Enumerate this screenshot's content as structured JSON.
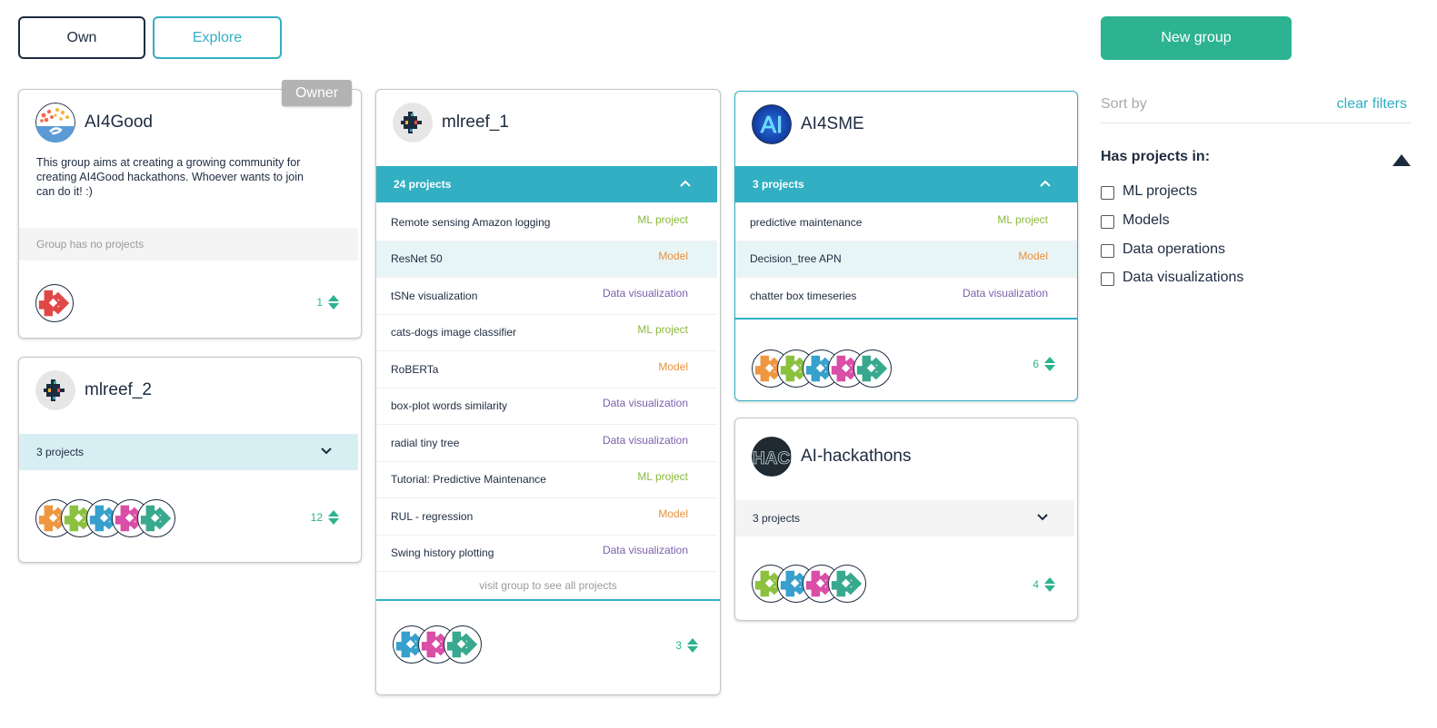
{
  "tabs": {
    "own": "Own",
    "explore": "Explore"
  },
  "new_group_label": "New group",
  "sidebar": {
    "sort_by": "Sort by",
    "clear_filters": "clear filters",
    "filter_heading": "Has projects in:",
    "filters": [
      {
        "label": "ML projects",
        "checked": false
      },
      {
        "label": "Models",
        "checked": false
      },
      {
        "label": "Data operations",
        "checked": false
      },
      {
        "label": "Data visualizations",
        "checked": false
      }
    ]
  },
  "colors": {
    "accent": "#32afc3",
    "primary": "#2db391",
    "dark": "#1d2b40",
    "ml_project": "#8ab93a",
    "model": "#e8923e",
    "data_visualization": "#7a5fad"
  },
  "groups": {
    "ai4good": {
      "name": "AI4Good",
      "badge": "Owner",
      "description": "This group aims at creating a growing community for creating AI4Good hackathons. Whoever wants to join can do it! :)",
      "no_projects": "Group has no projects",
      "member_icons": [
        "red-mlreef-icon"
      ],
      "stars": "1"
    },
    "mlreef_2": {
      "name": "mlreef_2",
      "projects_label": "3 projects",
      "member_icons": [
        "orange-mlreef-icon",
        "green-mlreef-icon",
        "blue-mlreef-icon",
        "pink-mlreef-icon",
        "teal-mlreef-icon"
      ],
      "stars": "12"
    },
    "mlreef_1": {
      "name": "mlreef_1",
      "projects_label": "24 projects",
      "projects": [
        {
          "name": "Remote sensing Amazon logging",
          "type": "ML project"
        },
        {
          "name": "ResNet 50",
          "type": "Model"
        },
        {
          "name": "tSNe visualization",
          "type": "Data visualization"
        },
        {
          "name": "cats-dogs image classifier",
          "type": "ML project"
        },
        {
          "name": "RoBERTa",
          "type": "Model"
        },
        {
          "name": "box-plot words similarity",
          "type": "Data visualization"
        },
        {
          "name": "radial tiny tree",
          "type": "Data visualization"
        },
        {
          "name": "Tutorial: Predictive Maintenance",
          "type": "ML project"
        },
        {
          "name": "RUL - regression",
          "type": "Model"
        },
        {
          "name": "Swing history plotting",
          "type": "Data visualization"
        }
      ],
      "visit_label": "visit group to see all projects",
      "member_icons": [
        "blue-mlreef-icon",
        "pink-mlreef-icon",
        "teal-mlreef-icon"
      ],
      "stars": "3"
    },
    "ai4sme": {
      "name": "AI4SME",
      "projects_label": "3 projects",
      "projects": [
        {
          "name": "predictive maintenance",
          "type": "ML project"
        },
        {
          "name": "Decision_tree APN",
          "type": "Model"
        },
        {
          "name": "chatter box timeseries",
          "type": "Data visualization"
        }
      ],
      "member_icons": [
        "orange-mlreef-icon",
        "green-mlreef-icon",
        "blue-mlreef-icon",
        "pink-mlreef-icon",
        "teal-mlreef-icon"
      ],
      "stars": "6"
    },
    "ai_hackathons": {
      "name": "AI-hackathons",
      "avatar_text": "HACK",
      "projects_label": "3 projects",
      "member_icons": [
        "green-mlreef-icon",
        "blue-mlreef-icon",
        "pink-mlreef-icon",
        "teal-mlreef-icon"
      ],
      "stars": "4"
    }
  }
}
